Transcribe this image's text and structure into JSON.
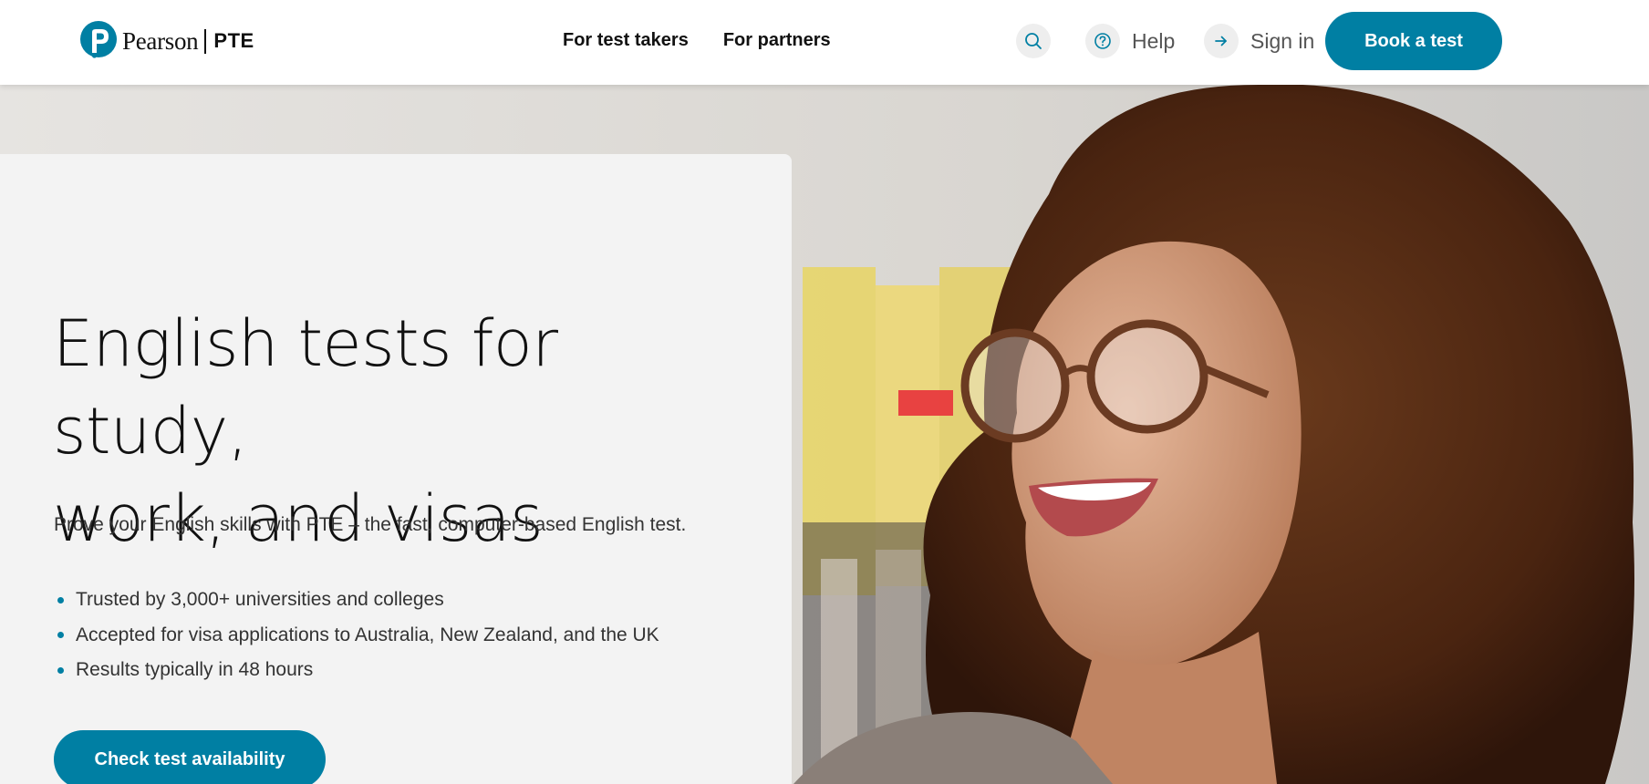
{
  "brand": {
    "name": "Pearson",
    "product": "PTE",
    "accent_color": "#007fa3"
  },
  "nav": {
    "items": [
      "For test takers",
      "For partners"
    ]
  },
  "utility": {
    "search_icon": "search-icon",
    "help_label": "Help",
    "signin_label": "Sign in",
    "book_label": "Book a test"
  },
  "hero": {
    "title_line1": "English tests for study,",
    "title_line2": "work, and visas",
    "intro": "Prove your English skills with PTE – the fast, computer-based English test.",
    "bullets": [
      "Trusted by 3,000+ universities and colleges",
      "Accepted for visa applications to Australia, New Zealand, and the UK",
      "Results typically in 48 hours"
    ],
    "cta_label": "Check test availability",
    "image": "smiling-woman-with-glasses-photo"
  }
}
